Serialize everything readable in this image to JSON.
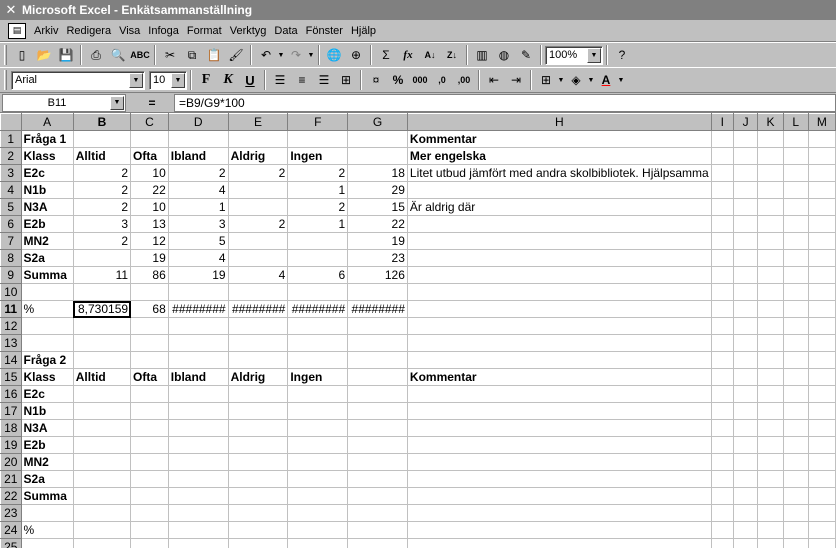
{
  "window": {
    "title": "Microsoft Excel - Enkätsammanställning"
  },
  "menu": {
    "items": [
      "Arkiv",
      "Redigera",
      "Visa",
      "Infoga",
      "Format",
      "Verktyg",
      "Data",
      "Fönster",
      "Hjälp"
    ]
  },
  "toolbar": {
    "zoom": "100%",
    "font_name": "Arial",
    "font_size": "10",
    "bold": "F",
    "italic": "K",
    "underline": "U"
  },
  "formula_bar": {
    "name_box": "B11",
    "equals": "=",
    "formula": "=B9/G9*100"
  },
  "columns": [
    "A",
    "B",
    "C",
    "D",
    "E",
    "F",
    "G",
    "H",
    "I",
    "J",
    "K",
    "L",
    "M"
  ],
  "active_cell": {
    "col": "B",
    "row": "11"
  },
  "rows": [
    {
      "n": "1",
      "cells": [
        "Fråga 1",
        "",
        "",
        "",
        "",
        "",
        "",
        "Kommentar",
        "",
        "",
        "",
        "",
        ""
      ]
    },
    {
      "n": "2",
      "cells": [
        "Klass",
        "Alltid",
        "Ofta",
        "Ibland",
        "Aldrig",
        "Ingen",
        "",
        "Mer engelska",
        "",
        "",
        "",
        "",
        ""
      ]
    },
    {
      "n": "3",
      "cells": [
        "E2c",
        "2",
        "10",
        "2",
        "2",
        "2",
        "18",
        "Litet utbud jämfört med andra skolbibliotek. Hjälpsamma",
        "",
        "",
        "",
        "",
        ""
      ]
    },
    {
      "n": "4",
      "cells": [
        "N1b",
        "2",
        "22",
        "4",
        "",
        "1",
        "29",
        "",
        "",
        "",
        "",
        "",
        ""
      ]
    },
    {
      "n": "5",
      "cells": [
        "N3A",
        "2",
        "10",
        "1",
        "",
        "2",
        "15",
        "Är aldrig där",
        "",
        "",
        "",
        "",
        ""
      ]
    },
    {
      "n": "6",
      "cells": [
        "E2b",
        "3",
        "13",
        "3",
        "2",
        "1",
        "22",
        "",
        "",
        "",
        "",
        "",
        ""
      ]
    },
    {
      "n": "7",
      "cells": [
        "MN2",
        "2",
        "12",
        "5",
        "",
        "",
        "19",
        "",
        "",
        "",
        "",
        "",
        ""
      ]
    },
    {
      "n": "8",
      "cells": [
        "S2a",
        "",
        "19",
        "4",
        "",
        "",
        "23",
        "",
        "",
        "",
        "",
        "",
        ""
      ]
    },
    {
      "n": "9",
      "cells": [
        "Summa",
        "11",
        "86",
        "19",
        "4",
        "6",
        "126",
        "",
        "",
        "",
        "",
        "",
        ""
      ]
    },
    {
      "n": "10",
      "cells": [
        "",
        "",
        "",
        "",
        "",
        "",
        "",
        "",
        "",
        "",
        "",
        "",
        ""
      ]
    },
    {
      "n": "11",
      "cells": [
        "%",
        "8,730159",
        "68",
        "########",
        "########",
        "########",
        "########",
        "",
        "",
        "",
        "",
        "",
        ""
      ]
    },
    {
      "n": "12",
      "cells": [
        "",
        "",
        "",
        "",
        "",
        "",
        "",
        "",
        "",
        "",
        "",
        "",
        ""
      ]
    },
    {
      "n": "13",
      "cells": [
        "",
        "",
        "",
        "",
        "",
        "",
        "",
        "",
        "",
        "",
        "",
        "",
        ""
      ]
    },
    {
      "n": "14",
      "cells": [
        "Fråga 2",
        "",
        "",
        "",
        "",
        "",
        "",
        "",
        "",
        "",
        "",
        "",
        ""
      ]
    },
    {
      "n": "15",
      "cells": [
        "Klass",
        "Alltid",
        "Ofta",
        "Ibland",
        "Aldrig",
        "Ingen",
        "",
        "Kommentar",
        "",
        "",
        "",
        "",
        ""
      ]
    },
    {
      "n": "16",
      "cells": [
        "E2c",
        "",
        "",
        "",
        "",
        "",
        "",
        "",
        "",
        "",
        "",
        "",
        ""
      ]
    },
    {
      "n": "17",
      "cells": [
        "N1b",
        "",
        "",
        "",
        "",
        "",
        "",
        "",
        "",
        "",
        "",
        "",
        ""
      ]
    },
    {
      "n": "18",
      "cells": [
        "N3A",
        "",
        "",
        "",
        "",
        "",
        "",
        "",
        "",
        "",
        "",
        "",
        ""
      ]
    },
    {
      "n": "19",
      "cells": [
        "E2b",
        "",
        "",
        "",
        "",
        "",
        "",
        "",
        "",
        "",
        "",
        "",
        ""
      ]
    },
    {
      "n": "20",
      "cells": [
        "MN2",
        "",
        "",
        "",
        "",
        "",
        "",
        "",
        "",
        "",
        "",
        "",
        ""
      ]
    },
    {
      "n": "21",
      "cells": [
        "S2a",
        "",
        "",
        "",
        "",
        "",
        "",
        "",
        "",
        "",
        "",
        "",
        ""
      ]
    },
    {
      "n": "22",
      "cells": [
        "Summa",
        "",
        "",
        "",
        "",
        "",
        "",
        "",
        "",
        "",
        "",
        "",
        ""
      ]
    },
    {
      "n": "23",
      "cells": [
        "",
        "",
        "",
        "",
        "",
        "",
        "",
        "",
        "",
        "",
        "",
        "",
        ""
      ]
    },
    {
      "n": "24",
      "cells": [
        "%",
        "",
        "",
        "",
        "",
        "",
        "",
        "",
        "",
        "",
        "",
        "",
        ""
      ]
    },
    {
      "n": "25",
      "cells": [
        "",
        "",
        "",
        "",
        "",
        "",
        "",
        "",
        "",
        "",
        "",
        "",
        ""
      ]
    }
  ]
}
